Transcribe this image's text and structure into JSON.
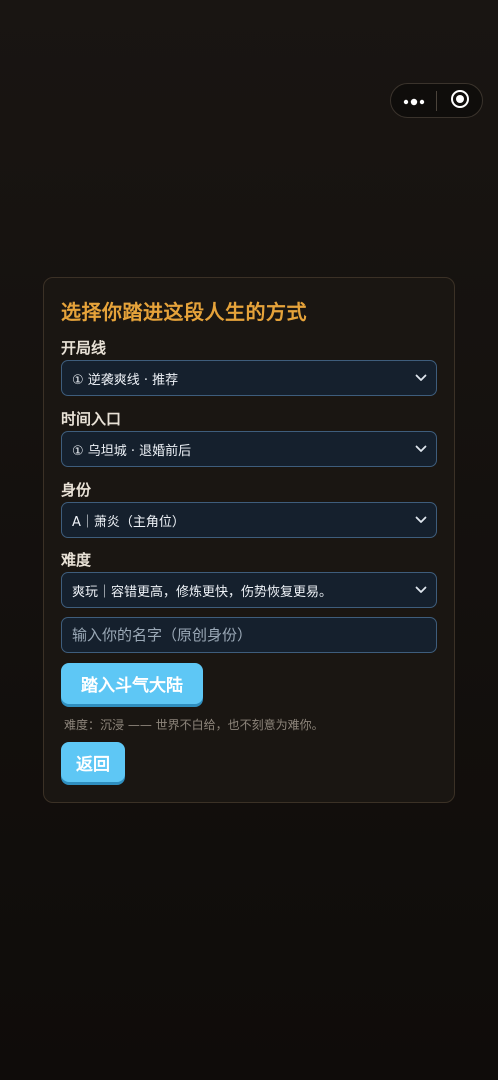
{
  "capsule": {
    "more_icon": "more-dots-icon",
    "close_icon": "target-circle-icon"
  },
  "card": {
    "title": "选择你踏进这段人生的方式",
    "fields": [
      {
        "label": "开局线",
        "value": "① 逆袭爽线 · 推荐"
      },
      {
        "label": "时间入口",
        "value": "① 乌坦城 · 退婚前后"
      },
      {
        "label": "身份",
        "value": "A｜萧炎（主角位）"
      },
      {
        "label": "难度",
        "value": "爽玩｜容错更高，修炼更快，伤势恢复更易。"
      }
    ],
    "name_input": {
      "placeholder": "输入你的名字（原创身份）",
      "value": ""
    },
    "enter_button": "踏入斗气大陆",
    "difficulty_hint": "难度：沉浸 —— 世界不白给，也不刻意为难你。",
    "back_button": "返回"
  },
  "colors": {
    "title": "#e6a33a",
    "button": "#5ec7f5",
    "select_bg": "#15202d",
    "select_border": "#3e5d7c"
  }
}
